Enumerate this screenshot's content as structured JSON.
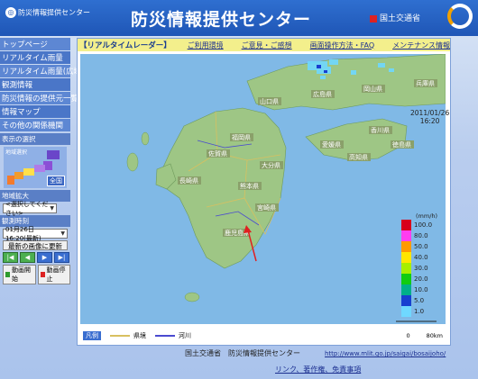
{
  "header": {
    "logo_text": "防災情報提供センター",
    "title": "防災情報提供センター",
    "ministry": "国土交通省"
  },
  "sidebar": {
    "items": [
      {
        "label": "トップページ"
      },
      {
        "label": "リアルタイム雨量"
      },
      {
        "label": "リアルタイム雨量(広域版)"
      },
      {
        "label": "観測情報"
      },
      {
        "label": "防災情報の提供元一覧"
      },
      {
        "label": "情報マップ"
      },
      {
        "label": "その他の関係機関"
      }
    ],
    "display_region_label": "表示の選択",
    "region_note": "地域選択",
    "whole_country_button": "全国",
    "zoom_label": "地域拡大",
    "zoom_select": "<選択してください>",
    "obs_time_label": "観測時刻",
    "obs_time_select": "01月26日 16:20(最新)",
    "update_button": "最新の画像に更新",
    "anim_start": "動画開始",
    "anim_stop": "動画停止"
  },
  "radar": {
    "title": "【リアルタイムレーダー】",
    "links": [
      {
        "label": "ご利用環境"
      },
      {
        "label": "ご意見・ご感想"
      },
      {
        "label": "画面操作方法・FAQ"
      },
      {
        "label": "メンテナンス情報"
      }
    ],
    "date": "2011/01/26",
    "time": "16:20",
    "unit": "(mm/h)",
    "scale": [
      {
        "label": "100.0",
        "color": "#d8001a"
      },
      {
        "label": "80.0",
        "color": "#ff3df0"
      },
      {
        "label": "50.0",
        "color": "#ff9a00"
      },
      {
        "label": "40.0",
        "color": "#ffe600"
      },
      {
        "label": "30.0",
        "color": "#a8ef00"
      },
      {
        "label": "20.0",
        "color": "#11cc11"
      },
      {
        "label": "10.0",
        "color": "#00b08a"
      },
      {
        "label": "5.0",
        "color": "#1740d0"
      },
      {
        "label": "1.0",
        "color": "#6fd8ff"
      }
    ],
    "prefectures": [
      "山口県",
      "福岡県",
      "佐賀県",
      "長崎県",
      "大分県",
      "熊本県",
      "宮崎県",
      "鹿児島県",
      "広島県",
      "岡山県",
      "兵庫県",
      "香川県",
      "徳島県",
      "愛媛県",
      "高知県"
    ],
    "legend_tag": "凡例",
    "legend_border": "県境",
    "legend_river": "河川",
    "scale_bar_left": "0",
    "scale_bar_right": "80km"
  },
  "footer": {
    "org": "国土交通省　防災情報提供センター",
    "url": "http://www.mlit.go.jp/saigai/bosaijoho/",
    "links": "リンク、著作権、免責事項"
  },
  "colors": {
    "header_blue": "#2f6fd0",
    "menu_yellow": "#f3ef8c",
    "sea": "#80b9e6",
    "land": "#9ec685"
  }
}
